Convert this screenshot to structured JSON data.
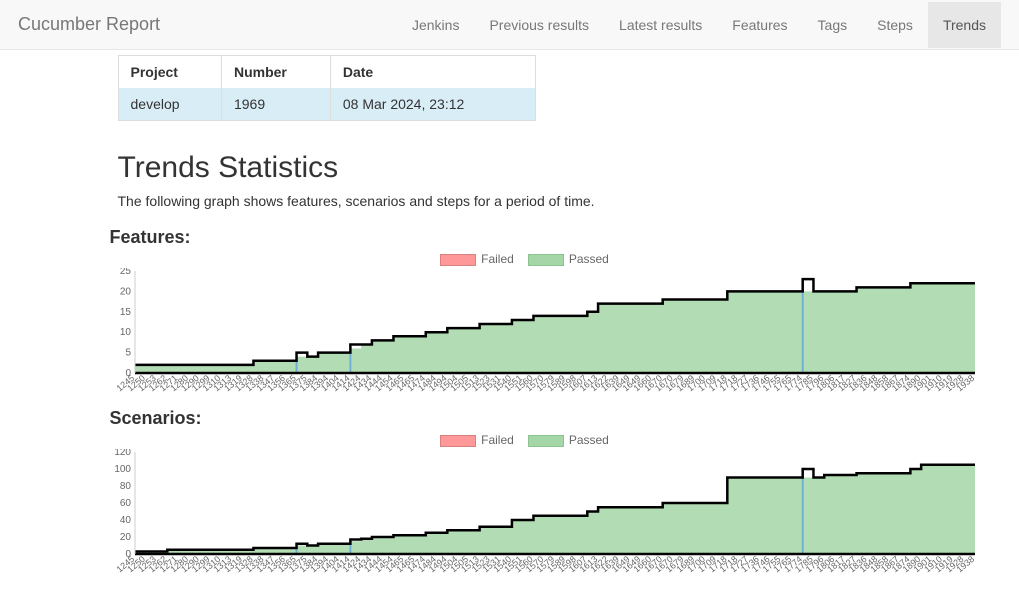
{
  "header": {
    "brand": "Cucumber Report",
    "nav": [
      "Jenkins",
      "Previous results",
      "Latest results",
      "Features",
      "Tags",
      "Steps",
      "Trends"
    ],
    "active": "Trends"
  },
  "build_table": {
    "headers": [
      "Project",
      "Number",
      "Date"
    ],
    "row": {
      "project": "develop",
      "number": "1969",
      "date": "08 Mar 2024, 23:12"
    }
  },
  "trends": {
    "title": "Trends Statistics",
    "subtitle": "The following graph shows features, scenarios and steps for a period of time."
  },
  "legend": {
    "failed": "Failed",
    "passed": "Passed"
  },
  "sections": {
    "features": "Features:",
    "scenarios": "Scenarios:"
  },
  "chart_data": [
    {
      "type": "area",
      "title": "Features",
      "xlabel": "",
      "ylabel": "",
      "ylim": [
        0,
        25
      ],
      "yticks": [
        0,
        5,
        10,
        15,
        20,
        25
      ],
      "categories": [
        "1245",
        "1250",
        "1253",
        "1262",
        "1271",
        "1280",
        "1290",
        "1299",
        "1310",
        "1313",
        "1319",
        "1328",
        "1338",
        "1347",
        "1356",
        "1365",
        "1375",
        "1384",
        "1394",
        "1404",
        "1414",
        "1424",
        "1434",
        "1444",
        "1454",
        "1465",
        "1465",
        "1474",
        "1484",
        "1494",
        "1504",
        "1505",
        "1513",
        "1523",
        "1531",
        "1540",
        "1551",
        "1560",
        "1570",
        "1579",
        "1589",
        "1598",
        "1607",
        "1613",
        "1622",
        "1639",
        "1649",
        "1649",
        "1660",
        "1670",
        "1670",
        "1679",
        "1689",
        "1700",
        "1709",
        "1718",
        "1718",
        "1727",
        "1736",
        "1746",
        "1755",
        "1765",
        "1774",
        "1785",
        "1796",
        "1806",
        "1817",
        "1827",
        "1836",
        "1848",
        "1858",
        "1867",
        "1874",
        "1890",
        "1901",
        "1910",
        "1919",
        "1928",
        "1938"
      ],
      "series": [
        {
          "name": "Passed",
          "color": "#a5d6a7",
          "values": [
            2,
            2,
            2,
            2,
            2,
            2,
            2,
            2,
            2,
            2,
            2,
            3,
            3,
            3,
            3,
            4,
            4,
            5,
            5,
            5,
            6,
            7,
            8,
            8,
            9,
            9,
            9,
            10,
            10,
            11,
            11,
            11,
            12,
            12,
            12,
            13,
            13,
            14,
            14,
            14,
            14,
            14,
            15,
            17,
            17,
            17,
            17,
            17,
            17,
            18,
            18,
            18,
            18,
            18,
            18,
            20,
            20,
            20,
            20,
            20,
            20,
            20,
            20,
            20,
            20,
            20,
            20,
            21,
            21,
            21,
            21,
            21,
            22,
            22,
            22,
            22,
            22,
            22,
            22
          ]
        },
        {
          "name": "Failed",
          "color": "#ff9999",
          "values": [
            0,
            0,
            0,
            0,
            0,
            0,
            0,
            0,
            0,
            0,
            0,
            0,
            0,
            0,
            0,
            1,
            0,
            0,
            0,
            0,
            1,
            0,
            0,
            0,
            0,
            0,
            0,
            0,
            0,
            0,
            0,
            0,
            0,
            0,
            0,
            0,
            0,
            0,
            0,
            0,
            0,
            0,
            0,
            0,
            0,
            0,
            0,
            0,
            0,
            0,
            0,
            0,
            0,
            0,
            0,
            0,
            0,
            0,
            0,
            0,
            0,
            0,
            3,
            0,
            0,
            0,
            0,
            0,
            0,
            0,
            0,
            0,
            0,
            0,
            0,
            0,
            0,
            0,
            0
          ]
        }
      ],
      "legend_position": "top"
    },
    {
      "type": "area",
      "title": "Scenarios",
      "xlabel": "",
      "ylabel": "",
      "ylim": [
        0,
        120
      ],
      "yticks": [
        0,
        20,
        40,
        60,
        80,
        100,
        120
      ],
      "categories": [
        "1245",
        "1250",
        "1253",
        "1262",
        "1271",
        "1280",
        "1290",
        "1299",
        "1310",
        "1313",
        "1319",
        "1328",
        "1338",
        "1347",
        "1356",
        "1365",
        "1375",
        "1384",
        "1394",
        "1404",
        "1414",
        "1424",
        "1434",
        "1444",
        "1454",
        "1465",
        "1465",
        "1474",
        "1484",
        "1494",
        "1504",
        "1505",
        "1513",
        "1523",
        "1531",
        "1540",
        "1551",
        "1560",
        "1570",
        "1579",
        "1589",
        "1598",
        "1607",
        "1613",
        "1622",
        "1639",
        "1649",
        "1649",
        "1660",
        "1670",
        "1670",
        "1679",
        "1689",
        "1700",
        "1709",
        "1718",
        "1718",
        "1727",
        "1736",
        "1746",
        "1755",
        "1765",
        "1774",
        "1785",
        "1796",
        "1806",
        "1817",
        "1827",
        "1836",
        "1848",
        "1858",
        "1867",
        "1874",
        "1890",
        "1901",
        "1910",
        "1919",
        "1928",
        "1938"
      ],
      "series": [
        {
          "name": "Passed",
          "color": "#a5d6a7",
          "values": [
            3,
            3,
            3,
            5,
            5,
            5,
            5,
            5,
            5,
            5,
            5,
            7,
            7,
            7,
            7,
            10,
            10,
            12,
            12,
            12,
            15,
            18,
            20,
            20,
            22,
            22,
            22,
            25,
            25,
            28,
            28,
            28,
            32,
            32,
            32,
            40,
            40,
            45,
            45,
            45,
            45,
            45,
            50,
            55,
            55,
            55,
            55,
            55,
            55,
            60,
            60,
            60,
            60,
            60,
            60,
            90,
            90,
            90,
            90,
            90,
            90,
            90,
            90,
            90,
            93,
            93,
            93,
            95,
            95,
            95,
            95,
            95,
            100,
            105,
            105,
            105,
            105,
            105,
            105
          ]
        },
        {
          "name": "Failed",
          "color": "#ff9999",
          "values": [
            0,
            0,
            0,
            0,
            0,
            0,
            0,
            0,
            0,
            0,
            0,
            0,
            0,
            0,
            0,
            2,
            0,
            0,
            0,
            0,
            2,
            0,
            0,
            0,
            0,
            0,
            0,
            0,
            0,
            0,
            0,
            0,
            0,
            0,
            0,
            0,
            0,
            0,
            0,
            0,
            0,
            0,
            0,
            0,
            0,
            0,
            0,
            0,
            0,
            0,
            0,
            0,
            0,
            0,
            0,
            0,
            0,
            0,
            0,
            0,
            0,
            0,
            10,
            0,
            0,
            0,
            0,
            0,
            0,
            0,
            0,
            0,
            0,
            0,
            0,
            0,
            0,
            0,
            0
          ]
        }
      ],
      "legend_position": "top"
    }
  ]
}
